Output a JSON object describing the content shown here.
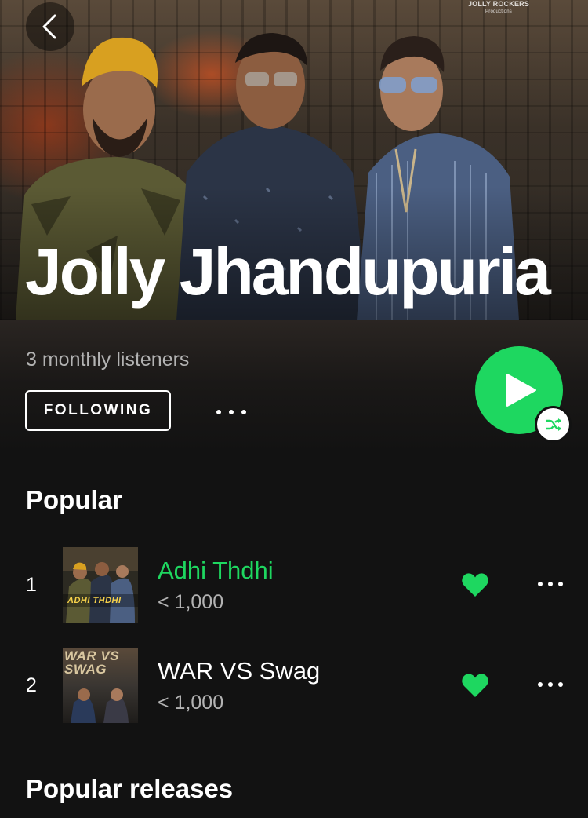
{
  "header": {
    "artist_name": "Jolly Jhandupuria",
    "logo_text": "JOLLY ROCKERS",
    "logo_subtext": "Productions"
  },
  "artist": {
    "monthly_listeners": "3 monthly listeners",
    "follow_label": "FOLLOWING"
  },
  "popular": {
    "title": "Popular",
    "tracks": [
      {
        "number": "1",
        "name": "Adhi Thdhi",
        "plays": "< 1,000",
        "liked": true,
        "playing": true,
        "cover_text": "ADHI THDHI"
      },
      {
        "number": "2",
        "name": "WAR VS Swag",
        "plays": "< 1,000",
        "liked": true,
        "playing": false,
        "cover_text": "WAR VS SWAG"
      }
    ]
  },
  "releases": {
    "title": "Popular releases"
  },
  "colors": {
    "accent": "#1ed760",
    "background": "#121212",
    "secondary_text": "#b3b3b3"
  },
  "icons": {
    "back": "chevron-left-icon",
    "more": "more-horizontal-icon",
    "play": "play-icon",
    "shuffle": "shuffle-icon",
    "heart": "heart-filled-icon"
  }
}
